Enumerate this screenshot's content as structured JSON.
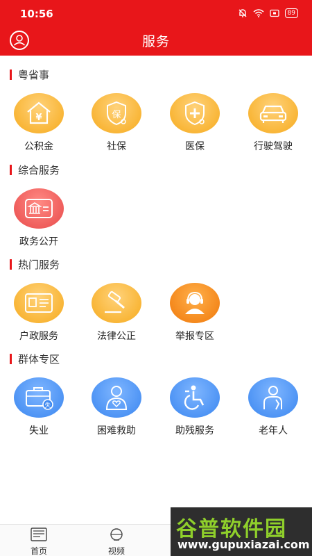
{
  "status_bar": {
    "time": "10:56",
    "battery": "89"
  },
  "header": {
    "title": "服务"
  },
  "sections": [
    {
      "title": "粤省事",
      "items": [
        {
          "label": "公积金",
          "icon": "house-yuan-icon",
          "color": "#f6aa1c"
        },
        {
          "label": "社保",
          "icon": "shield-bao-icon",
          "color": "#f6aa1c"
        },
        {
          "label": "医保",
          "icon": "shield-plus-icon",
          "color": "#f6aa1c"
        },
        {
          "label": "行驶驾驶",
          "icon": "car-icon",
          "color": "#f6aa1c"
        }
      ]
    },
    {
      "title": "综合服务",
      "items": [
        {
          "label": "政务公开",
          "icon": "government-building-icon",
          "color": "#e84a4a"
        }
      ]
    },
    {
      "title": "热门服务",
      "items": [
        {
          "label": "户政服务",
          "icon": "id-card-icon",
          "color": "#f6aa1c"
        },
        {
          "label": "法律公正",
          "icon": "gavel-icon",
          "color": "#f6aa1c"
        },
        {
          "label": "举报专区",
          "icon": "headset-agent-icon",
          "color": "#f0780a"
        }
      ]
    },
    {
      "title": "群体专区",
      "items": [
        {
          "label": "失业",
          "icon": "briefcase-shi-icon",
          "color": "#3a86f0"
        },
        {
          "label": "困难救助",
          "icon": "person-heart-icon",
          "color": "#3a86f0"
        },
        {
          "label": "助残服务",
          "icon": "wheelchair-icon",
          "color": "#3a86f0"
        },
        {
          "label": "老年人",
          "icon": "elderly-icon",
          "color": "#3a86f0"
        }
      ]
    }
  ],
  "tabbar": {
    "items": [
      {
        "label": "首页",
        "icon": "news-icon"
      },
      {
        "label": "视频",
        "icon": "video-icon"
      }
    ]
  },
  "watermark": {
    "line1": "谷普软件园",
    "line2": "www.gupuxiazai.com"
  }
}
